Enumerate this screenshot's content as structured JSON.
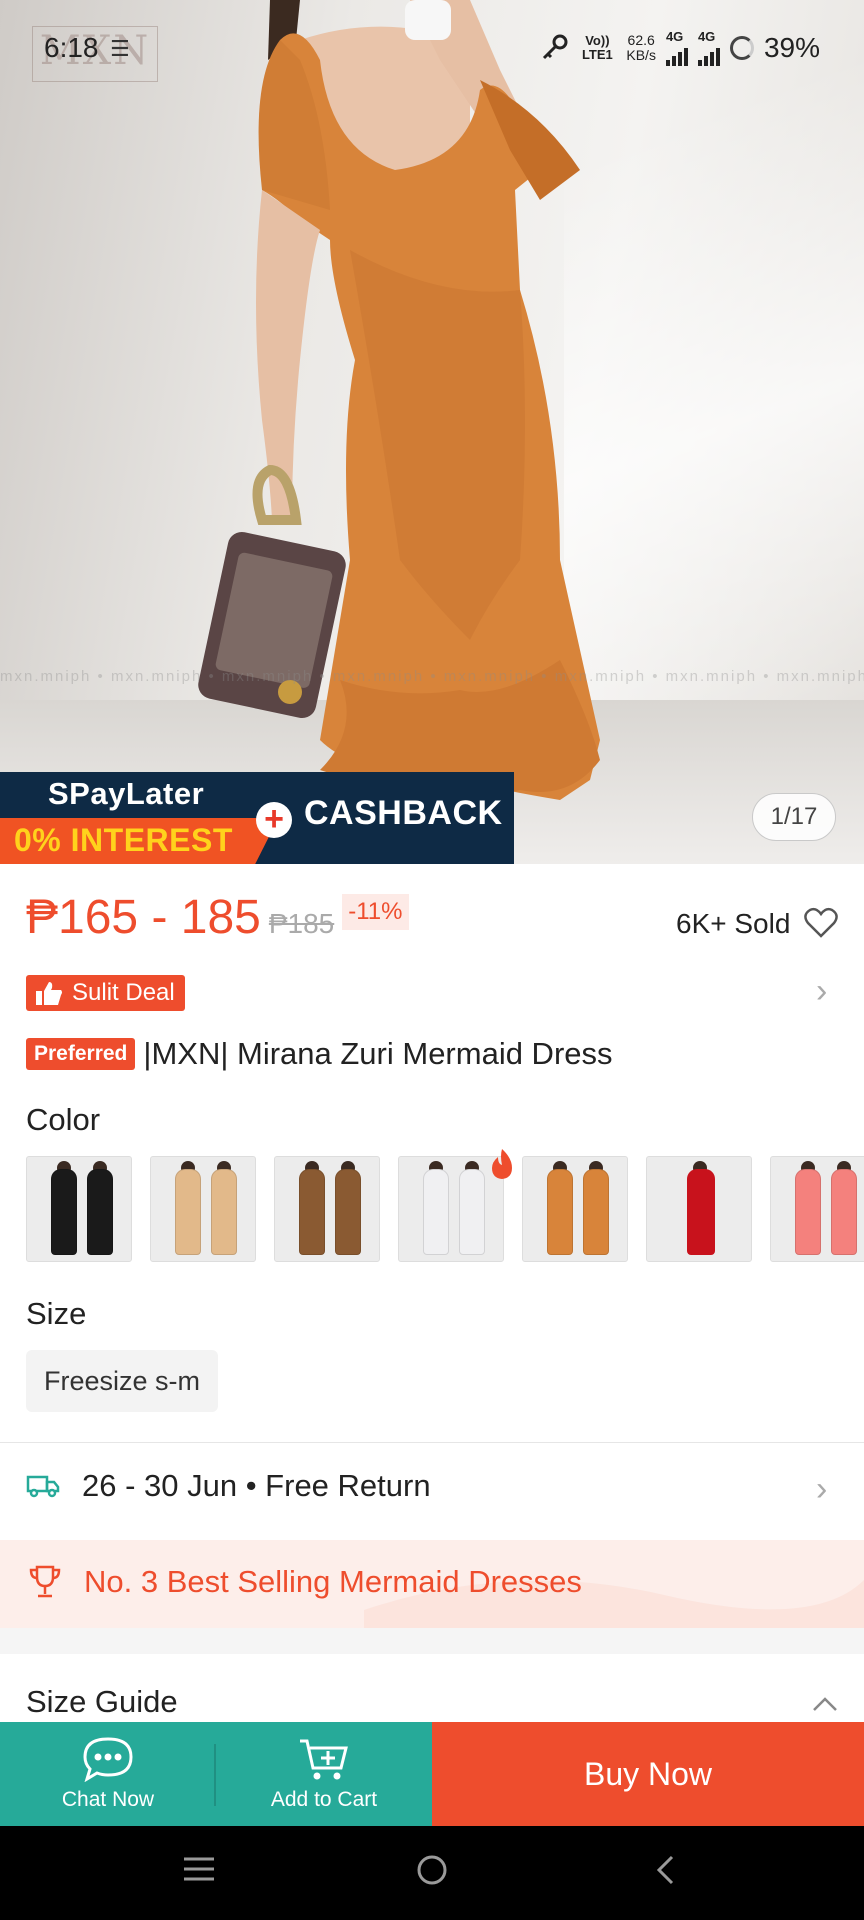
{
  "status_bar": {
    "time": "6:18",
    "volte": "Vo)) LTE1",
    "net_speed_value": "62.6",
    "net_speed_unit": "KB/s",
    "sim1": "4G",
    "sim2": "4G",
    "battery": "39%"
  },
  "hero": {
    "brand_logo": "MXN",
    "watermark": "mxn.mniph • mxn.mniph • mxn.mniph • mxn.mniph • mxn.mniph • mxn.mniph • mxn.mniph • mxn.mniph",
    "banner": {
      "spaylater": "SPayLater",
      "interest": "0% INTEREST",
      "cashback": "CASHBACK"
    },
    "image_counter": "1/17"
  },
  "product": {
    "price_range": "₱165 - 185",
    "original_price": "₱185",
    "discount": "-11%",
    "sold": "6K+ Sold",
    "deal_badge": "Sulit Deal",
    "preferred_badge": "Preferred",
    "title": "|MXN| Mirana Zuri Mermaid Dress"
  },
  "variations": {
    "color_label": "Color",
    "colors": [
      {
        "name": "black",
        "color": "#1a1a1a"
      },
      {
        "name": "beige",
        "color": "#e2b98a"
      },
      {
        "name": "brown",
        "color": "#8a5a32"
      },
      {
        "name": "white",
        "color": "#f0f0f2"
      },
      {
        "name": "orange",
        "color": "#d8843a"
      },
      {
        "name": "red",
        "color": "#c8121c"
      },
      {
        "name": "pink",
        "color": "#f4817d"
      }
    ],
    "size_label": "Size",
    "size_option": "Freesize s-m"
  },
  "shipping": {
    "text": "26 - 30 Jun • Free Return"
  },
  "ranking": {
    "text": "No. 3 Best Selling Mermaid Dresses"
  },
  "size_guide": {
    "label": "Size Guide"
  },
  "bottom_bar": {
    "chat": "Chat Now",
    "cart": "Add to Cart",
    "buy": "Buy Now"
  },
  "colors": {
    "accent": "#ee4d2d",
    "teal": "#26aa99"
  }
}
